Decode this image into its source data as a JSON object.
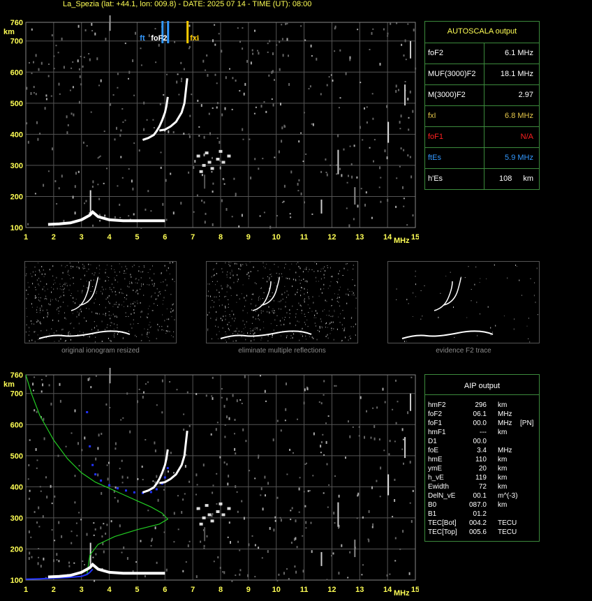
{
  "header": {
    "title": "La_Spezia (lat: +44.1, lon: 009.8) - DATE: 2025 07 14 - TIME (UT): 08:00"
  },
  "colors": {
    "background": "#000000",
    "grid": "#555555",
    "axis_text": "#ffff55",
    "panel_border": "#3c8a3c",
    "trace": "#ffffff",
    "foF2_marker": "#3399ff",
    "fxI_marker": "#ffcc00",
    "profile": "#22cc22",
    "aip_trace": "#2233ff"
  },
  "autoscala": {
    "title": "AUTOSCALA output",
    "rows": [
      {
        "label": "foF2",
        "value": "6.1 MHz",
        "color": "#ffffff"
      },
      {
        "label": "MUF(3000)F2",
        "value": "18.1 MHz",
        "color": "#ffffff"
      },
      {
        "label": "M(3000)F2",
        "value": "2.97",
        "color": "#ffffff"
      },
      {
        "label": "fxI",
        "value": "6.8 MHz",
        "color": "#e6c84a"
      },
      {
        "label": "foF1",
        "value": "N/A",
        "color": "#ff2020"
      },
      {
        "label": "ftEs",
        "value": "5.9 MHz",
        "color": "#3399ff"
      },
      {
        "label": "h'Es",
        "value": "108",
        "unit": "km",
        "color": "#ffffff"
      }
    ]
  },
  "thumbnails": {
    "captions": [
      "original ionogram resized",
      "eliminate multiple reflections",
      "evidence F2 trace"
    ]
  },
  "aip": {
    "title": "AIP output",
    "rows": [
      {
        "label": "hmF2",
        "value": "296",
        "unit": "km",
        "extra": ""
      },
      {
        "label": "foF2",
        "value": "06.1",
        "unit": "MHz",
        "extra": ""
      },
      {
        "label": "foF1",
        "value": "00.0",
        "unit": "MHz",
        "extra": "[PN]"
      },
      {
        "label": "hmF1",
        "value": "---",
        "unit": "km",
        "extra": ""
      },
      {
        "label": "D1",
        "value": "00.0",
        "unit": "",
        "extra": ""
      },
      {
        "label": "foE",
        "value": "3.4",
        "unit": "MHz",
        "extra": ""
      },
      {
        "label": "hmE",
        "value": "110",
        "unit": "km",
        "extra": ""
      },
      {
        "label": "ymE",
        "value": "20",
        "unit": "km",
        "extra": ""
      },
      {
        "label": "h_vE",
        "value": "119",
        "unit": "km",
        "extra": ""
      },
      {
        "label": "Ewidth",
        "value": "72",
        "unit": "km",
        "extra": ""
      },
      {
        "label": "DelN_vE",
        "value": "00.1",
        "unit": "m^(-3)",
        "extra": ""
      },
      {
        "label": "B0",
        "value": "087.0",
        "unit": "km",
        "extra": ""
      },
      {
        "label": "B1",
        "value": "01.2",
        "unit": "",
        "extra": ""
      },
      {
        "label": "TEC[Bot]",
        "value": "004.2",
        "unit": "TECU",
        "extra": ""
      },
      {
        "label": "TEC[Top]",
        "value": "005.6",
        "unit": "TECU",
        "extra": ""
      }
    ]
  },
  "chart_data": [
    {
      "type": "scatter",
      "name": "ionogram-autoscala",
      "xlabel": "MHz",
      "ylabel": "km",
      "xlim": [
        1,
        15
      ],
      "ylim": [
        100,
        760
      ],
      "xticks": [
        1,
        2,
        3,
        4,
        5,
        6,
        7,
        8,
        9,
        10,
        11,
        12,
        13,
        14,
        15
      ],
      "yticks": [
        100,
        200,
        300,
        400,
        500,
        600,
        700,
        760
      ],
      "grid": true,
      "markers": [
        {
          "label": "ft",
          "x": 5.9,
          "color": "#3399ff"
        },
        {
          "label": "foF2",
          "x": 6.1,
          "color": "#3399ff"
        },
        {
          "label": "fxI",
          "x": 6.8,
          "color": "#ffcc00"
        }
      ],
      "traces": {
        "E_layer": {
          "x": [
            1.8,
            2.2,
            2.6,
            3.0,
            3.3,
            3.4,
            3.6,
            4.0,
            4.5,
            5.0,
            5.5,
            6.0
          ],
          "y": [
            110,
            112,
            115,
            125,
            140,
            150,
            135,
            125,
            122,
            122,
            122,
            122
          ]
        },
        "F2_ordinary": {
          "x": [
            5.2,
            5.4,
            5.6,
            5.7,
            5.8,
            5.9,
            6.0,
            6.05,
            6.1
          ],
          "y": [
            382,
            388,
            398,
            410,
            425,
            445,
            470,
            490,
            520
          ]
        },
        "F2_extraordinary": {
          "x": [
            5.8,
            6.0,
            6.2,
            6.4,
            6.6,
            6.7,
            6.75,
            6.8
          ],
          "y": [
            412,
            415,
            425,
            440,
            470,
            500,
            540,
            580
          ]
        },
        "spread_F": {
          "x": [
            7.2,
            7.4,
            7.5,
            7.7,
            7.9,
            8.1,
            8.3,
            7.3,
            7.6,
            8.0
          ],
          "y": [
            330,
            300,
            340,
            290,
            320,
            310,
            330,
            280,
            310,
            345
          ]
        }
      }
    },
    {
      "type": "line",
      "name": "ionogram-aip",
      "xlabel": "MHz",
      "ylabel": "km",
      "xlim": [
        1,
        15
      ],
      "ylim": [
        100,
        760
      ],
      "xticks": [
        1,
        2,
        3,
        4,
        5,
        6,
        7,
        8,
        9,
        10,
        11,
        12,
        13,
        14,
        15
      ],
      "yticks": [
        100,
        200,
        300,
        400,
        500,
        600,
        700,
        760
      ],
      "grid": true,
      "profile": {
        "x": [
          1.0,
          1.2,
          1.5,
          2.0,
          2.5,
          3.0,
          3.5,
          4.0,
          4.5,
          5.0,
          5.5,
          5.9,
          6.1,
          5.8,
          5.0,
          4.2,
          3.6,
          3.3,
          3.2
        ],
        "y": [
          760,
          700,
          630,
          550,
          490,
          445,
          415,
          395,
          375,
          355,
          335,
          315,
          296,
          280,
          262,
          240,
          215,
          180,
          120
        ]
      },
      "aip_trace": {
        "x": [
          3.2,
          3.3,
          3.4,
          3.5,
          3.7,
          4.0,
          4.3,
          4.6,
          4.9,
          5.2,
          5.5,
          5.7,
          5.9,
          6.0,
          6.1
        ],
        "y": [
          640,
          530,
          470,
          440,
          420,
          405,
          395,
          388,
          382,
          380,
          383,
          392,
          410,
          430,
          460
        ]
      },
      "E_trace": {
        "x": [
          1.0,
          1.5,
          2.0,
          2.5,
          3.0,
          3.2,
          3.3,
          3.4
        ],
        "y": [
          103,
          104,
          106,
          108,
          112,
          118,
          125,
          135
        ]
      }
    }
  ]
}
